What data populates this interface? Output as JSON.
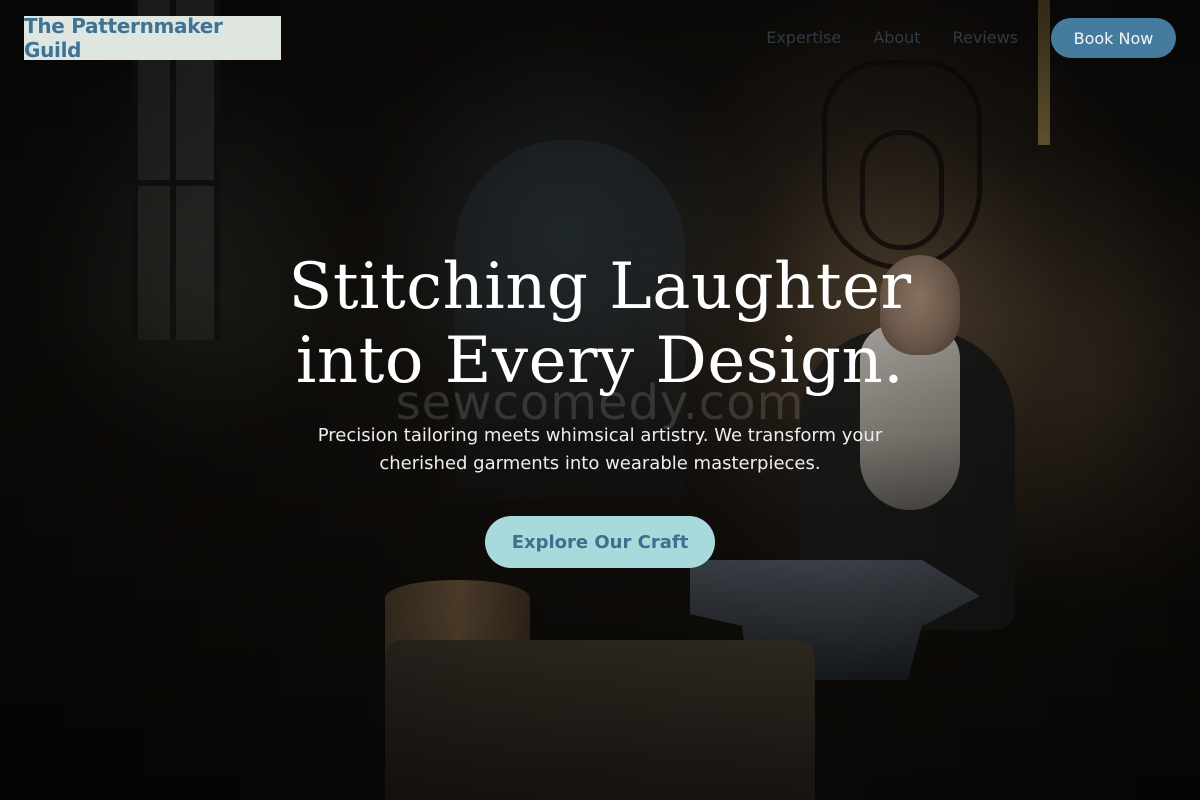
{
  "brand": {
    "name": "The Patternmaker Guild"
  },
  "nav": {
    "links": [
      "Expertise",
      "About",
      "Reviews"
    ],
    "cta_label": "Book Now"
  },
  "hero": {
    "title_line1": "Stitching Laughter",
    "title_line2": "into Every Design.",
    "watermark": "sewcomedy.com",
    "subtitle": "Precision tailoring meets whimsical artistry. We transform your cherished garments into wearable masterpieces.",
    "cta_label": "Explore Our Craft"
  },
  "colors": {
    "brand_bg": "#dfe6df",
    "brand_text": "#3f7396",
    "book_button": "#457b9d",
    "cta_button": "#a8dadc",
    "cta_text": "#3d6f8e"
  }
}
